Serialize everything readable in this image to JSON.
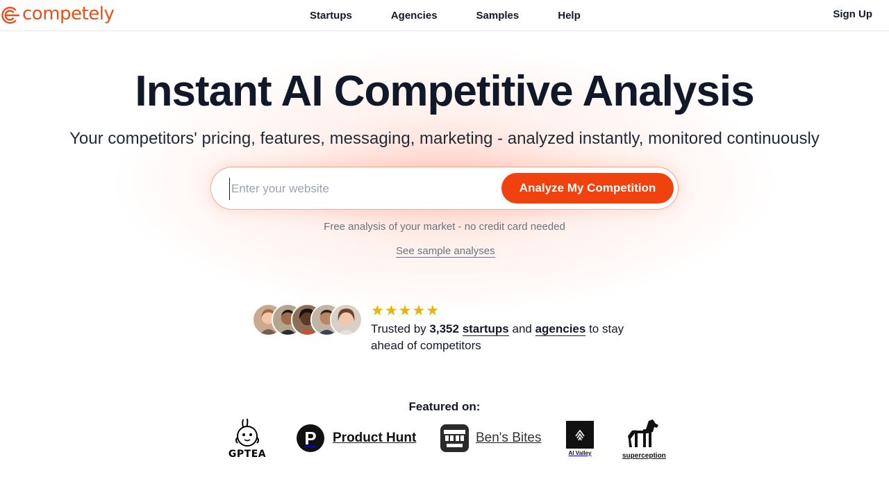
{
  "header": {
    "logo_text": "competely",
    "nav": [
      {
        "label": "Startups"
      },
      {
        "label": "Agencies"
      },
      {
        "label": "Samples"
      },
      {
        "label": "Help"
      }
    ],
    "signup_label": "Sign Up"
  },
  "hero": {
    "title": "Instant AI Competitive Analysis",
    "subtitle": "Your competitors' pricing, features, messaging, marketing - analyzed instantly, monitored continuously",
    "input_placeholder": "Enter your website",
    "input_value": "",
    "cta_label": "Analyze My Competition",
    "note": "Free analysis of your market - no credit card needed",
    "sample_link": "See sample analyses"
  },
  "social_proof": {
    "rating_stars": 5,
    "trust_prefix": "Trusted by ",
    "count": "3,352",
    "startups_link": "startups",
    "and_text": " and ",
    "agencies_link": "agencies",
    "trust_suffix": " to stay ahead of competitors"
  },
  "featured": {
    "title": "Featured on:",
    "logos": [
      {
        "name": "GPTEA",
        "icon": "gptea-logo"
      },
      {
        "name": "Product Hunt",
        "icon": "product-hunt-logo"
      },
      {
        "name": "Ben's Bites",
        "icon": "bens-bites-logo"
      },
      {
        "name": "AI Valley",
        "icon": "ai-valley-logo"
      },
      {
        "name": "superception",
        "icon": "superception-logo"
      }
    ]
  },
  "colors": {
    "brand": "#e8501a",
    "cta": "#f0420f",
    "star": "#eab308",
    "text": "#111827"
  }
}
